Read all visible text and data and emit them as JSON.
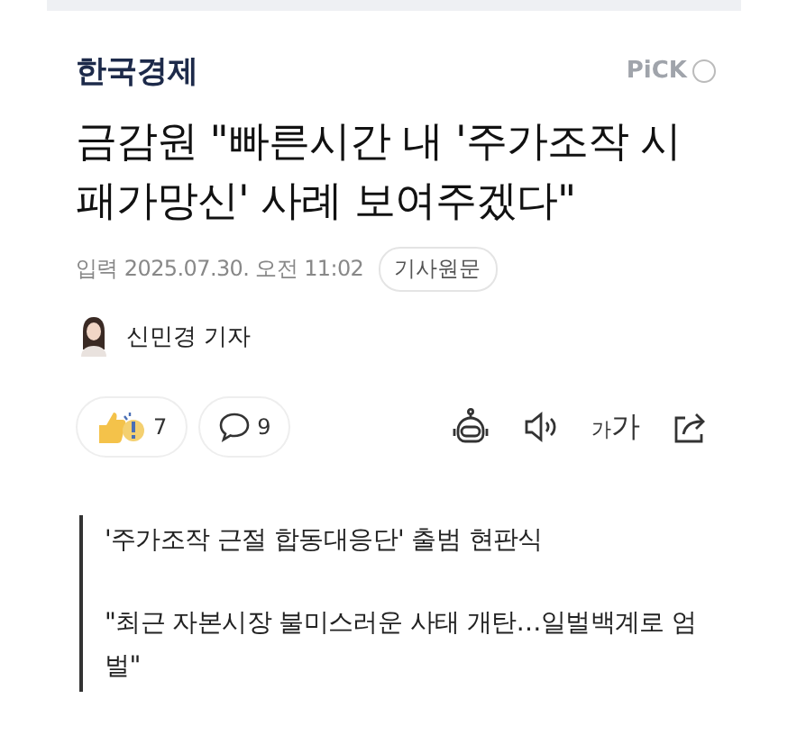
{
  "press": {
    "name": "한국경제",
    "badge": "PiCK"
  },
  "headline": "금감원 \"빠른시간 내 '주가조작 시 패가망신' 사례 보여주겠다\"",
  "meta": {
    "published": "입력 2025.07.30. 오전 11:02",
    "source_button": "기사원문"
  },
  "reporter": {
    "name": "신민경 기자"
  },
  "reactions": [
    {
      "kind": "emotion",
      "count": "7"
    },
    {
      "kind": "comment",
      "count": "9"
    }
  ],
  "tools": [
    {
      "kind": "summary"
    },
    {
      "kind": "audio"
    },
    {
      "kind": "font",
      "label": "가가"
    },
    {
      "kind": "share"
    }
  ],
  "quote": [
    "'주가조작 근절 합동대응단' 출범 현판식",
    "\"최근 자본시장 불미스러운 사태 개탄…일벌백계로 엄벌\""
  ]
}
